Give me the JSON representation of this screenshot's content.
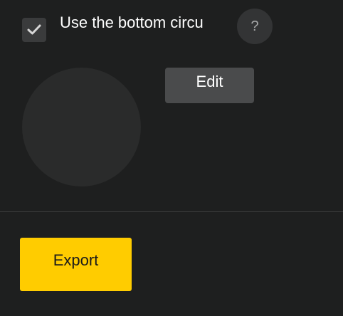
{
  "option": {
    "checked": true,
    "label": "Use the bottom circu"
  },
  "help": {
    "label": "?",
    "icon": "question-mark-icon"
  },
  "edit": {
    "label": "Edit"
  },
  "export": {
    "label": "Export"
  },
  "colors": {
    "background": "#1e1f1f",
    "accent": "#ffcc00",
    "checkbox_bg": "#3a3b3c",
    "button_bg": "#4a4b4c",
    "circle_bg": "#2a2b2b"
  }
}
